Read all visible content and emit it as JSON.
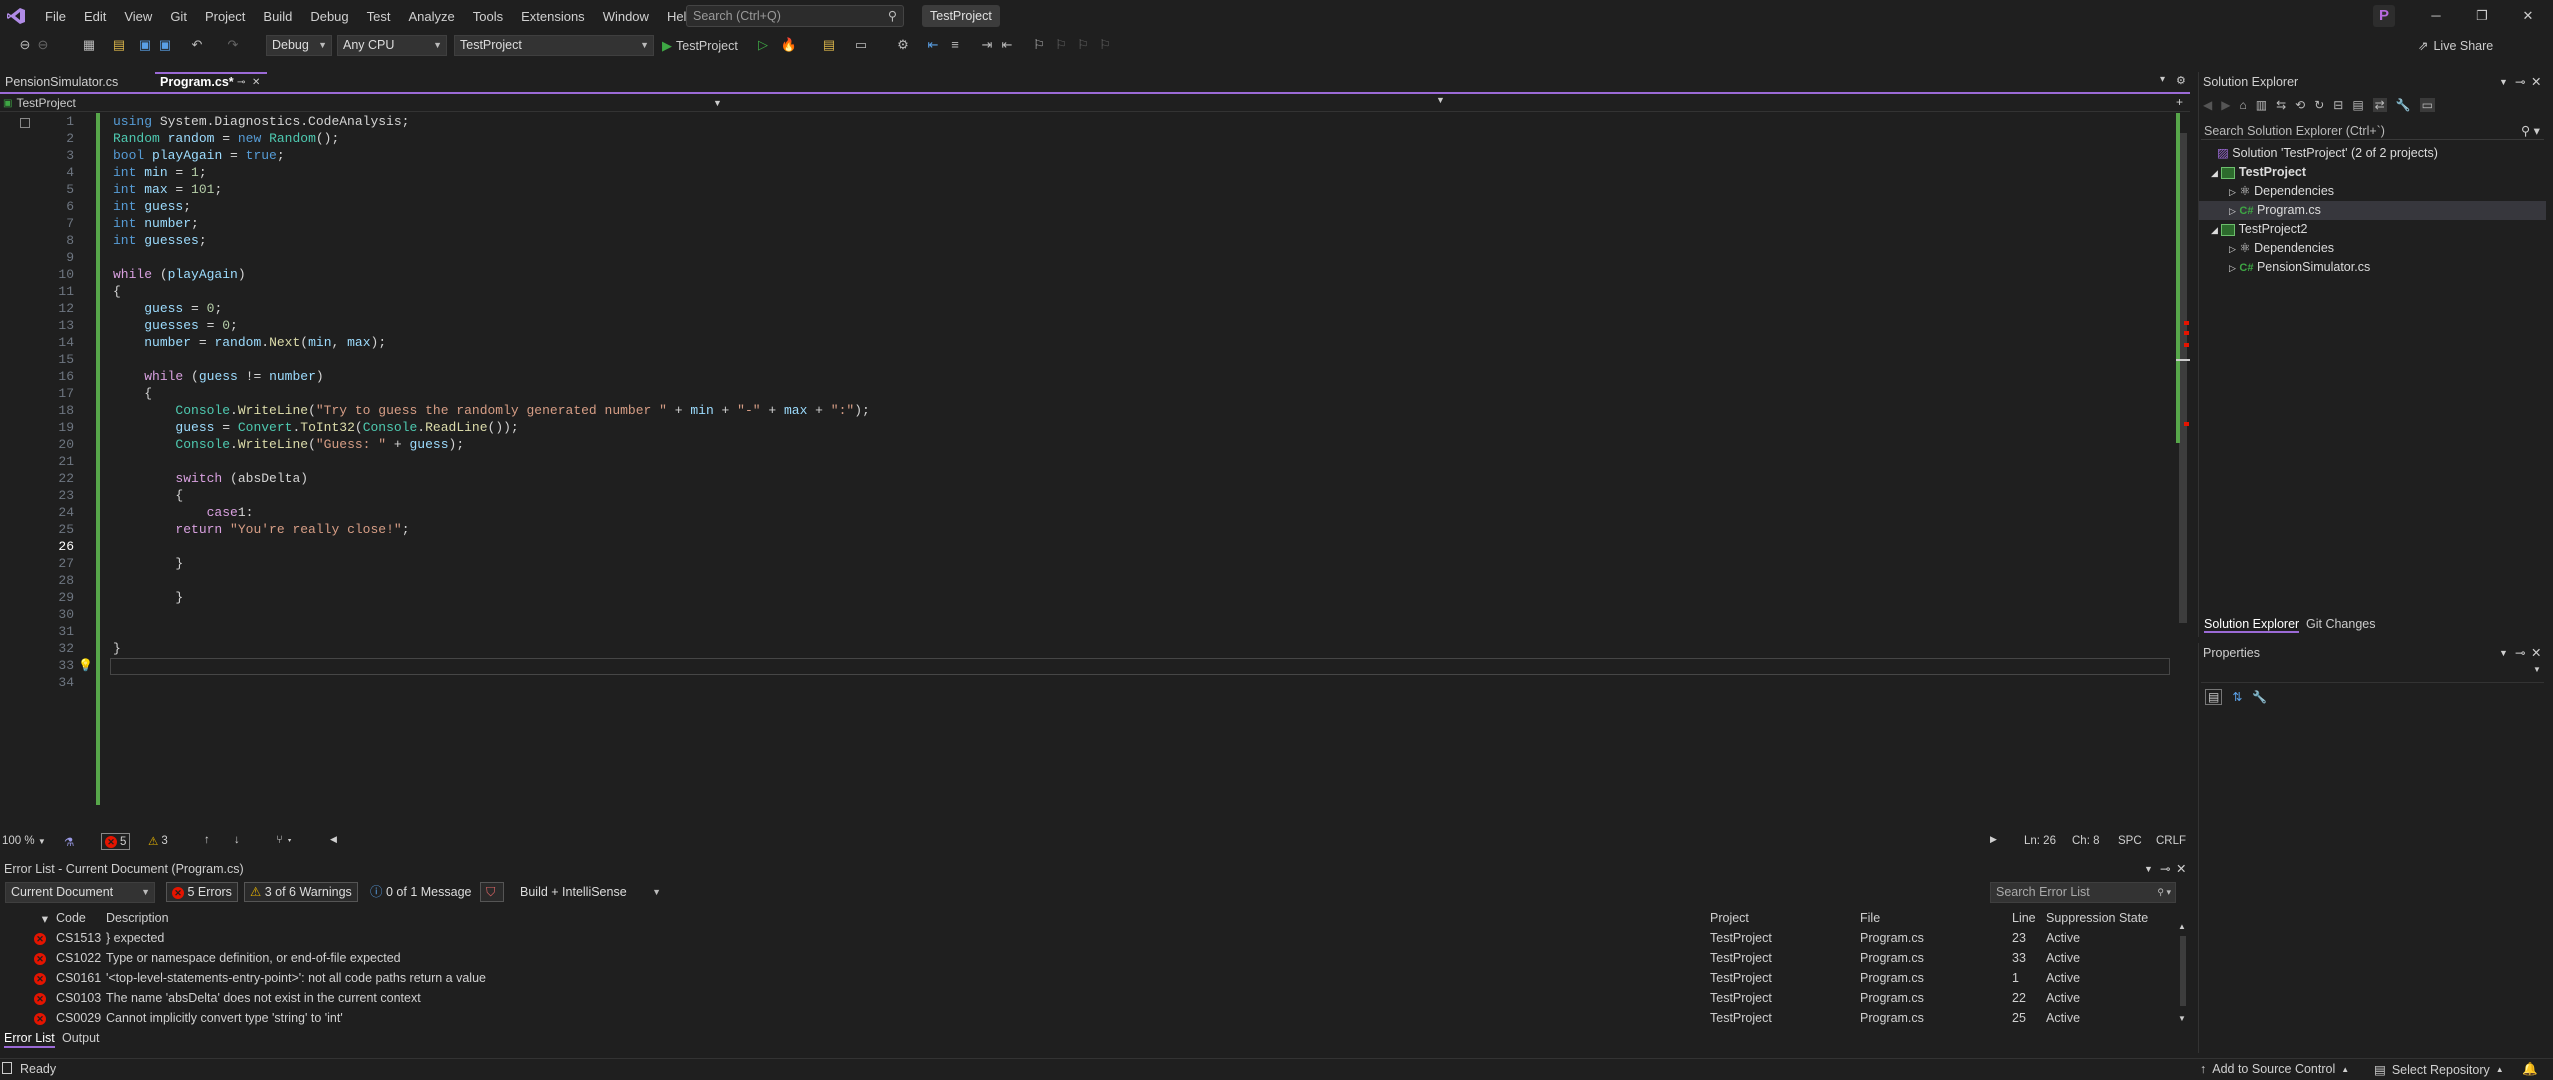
{
  "menu": [
    "File",
    "Edit",
    "View",
    "Git",
    "Project",
    "Build",
    "Debug",
    "Test",
    "Analyze",
    "Tools",
    "Extensions",
    "Window",
    "Help"
  ],
  "search": {
    "placeholder": "Search (Ctrl+Q)"
  },
  "project_pill": "TestProject",
  "avatar_letter": "P",
  "live_share": "Live Share",
  "toolbar": {
    "config": "Debug",
    "platform": "Any CPU",
    "startup": "TestProject",
    "run_label": "TestProject"
  },
  "tabs": [
    {
      "label": "PensionSimulator.cs"
    },
    {
      "label": "Program.cs*"
    }
  ],
  "navbar": {
    "project": "TestProject"
  },
  "editor": {
    "line_numbers": [
      "1",
      "2",
      "3",
      "4",
      "5",
      "6",
      "7",
      "8",
      "9",
      "10",
      "11",
      "12",
      "13",
      "14",
      "15",
      "16",
      "17",
      "18",
      "19",
      "20",
      "21",
      "22",
      "23",
      "24",
      "25",
      "26",
      "27",
      "28",
      "29",
      "30",
      "31",
      "32",
      "33",
      "34"
    ],
    "zoom": "100 %",
    "errors": "5",
    "warnings": "3",
    "ln": "Ln: 26",
    "ch": "Ch: 8",
    "spc": "SPC",
    "crlf": "CRLF"
  },
  "error_list": {
    "title": "Error List - Current Document (Program.cs)",
    "scope": "Current Document",
    "errors_chip": "5 Errors",
    "warnings_chip": "3 of 6 Warnings",
    "messages_chip": "0 of 1 Message",
    "build_filter": "Build + IntelliSense",
    "search_placeholder": "Search Error List",
    "headers": {
      "code": "Code",
      "description": "Description",
      "project": "Project",
      "file": "File",
      "line": "Line",
      "suppression": "Suppression State"
    },
    "rows": [
      {
        "code": "CS1513",
        "description": "} expected",
        "project": "TestProject",
        "file": "Program.cs",
        "line": "23",
        "state": "Active"
      },
      {
        "code": "CS1022",
        "description": "Type or namespace definition, or end-of-file expected",
        "project": "TestProject",
        "file": "Program.cs",
        "line": "33",
        "state": "Active"
      },
      {
        "code": "CS0161",
        "description": "'<top-level-statements-entry-point>': not all code paths return a value",
        "project": "TestProject",
        "file": "Program.cs",
        "line": "1",
        "state": "Active"
      },
      {
        "code": "CS0103",
        "description": "The name 'absDelta' does not exist in the current context",
        "project": "TestProject",
        "file": "Program.cs",
        "line": "22",
        "state": "Active"
      },
      {
        "code": "CS0029",
        "description": "Cannot implicitly convert type 'string' to 'int'",
        "project": "TestProject",
        "file": "Program.cs",
        "line": "25",
        "state": "Active"
      }
    ]
  },
  "bottom_tabs": [
    "Error List",
    "Output"
  ],
  "status": {
    "ready": "Ready",
    "add_source": "Add to Source Control",
    "select_repo": "Select Repository"
  },
  "solution_explorer": {
    "title": "Solution Explorer",
    "search_placeholder": "Search Solution Explorer (Ctrl+`)",
    "solution": "Solution 'TestProject' (2 of 2 projects)",
    "project1": "TestProject",
    "p1_deps": "Dependencies",
    "p1_file": "Program.cs",
    "project2": "TestProject2",
    "p2_deps": "Dependencies",
    "p2_file": "PensionSimulator.cs",
    "tab_se": "Solution Explorer",
    "tab_git": "Git Changes"
  },
  "properties": {
    "title": "Properties"
  },
  "colors": {
    "accent": "#9b6ad6",
    "error": "#e51400",
    "warning": "#e8b400",
    "green": "#57a64a"
  }
}
